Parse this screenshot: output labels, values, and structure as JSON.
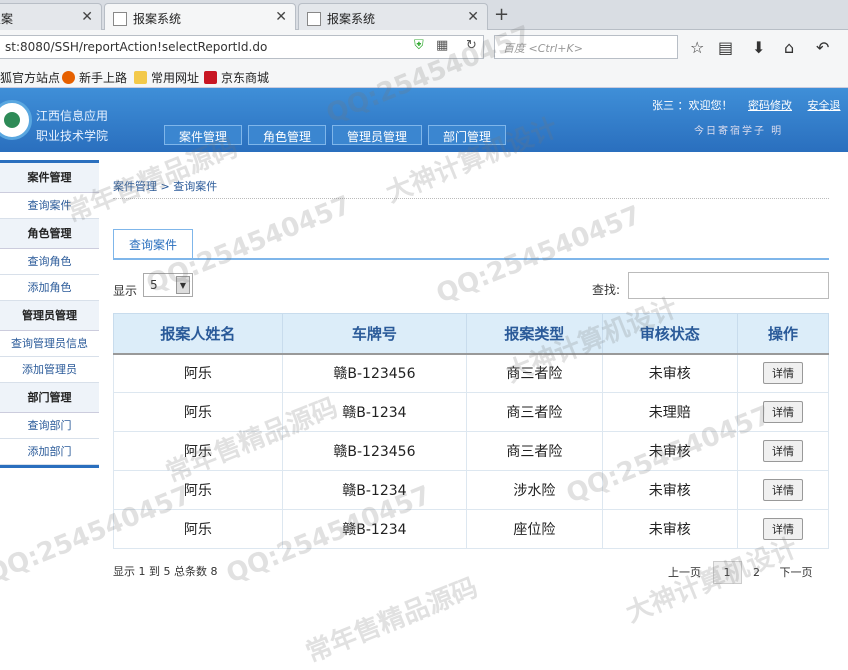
{
  "browser": {
    "tabs": [
      {
        "title": "搜案"
      },
      {
        "title": "报案系统"
      },
      {
        "title": "报案系统"
      }
    ],
    "url": "st:8080/SSH/reportAction!selectReportId.do",
    "search_placeholder": "百度 <Ctrl+K>",
    "bookmarks": [
      "狐官方站点",
      "新手上路",
      "常用网址",
      "京东商城"
    ]
  },
  "app": {
    "school_line1": "江西信息应用",
    "school_line2": "职业技术学院",
    "nav": [
      "案件管理",
      "角色管理",
      "管理员管理",
      "部门管理"
    ],
    "welcome": "张三 ：欢迎您！",
    "change_password": "密码修改",
    "logout": "安全退",
    "motto": "今日寄宿学子      明"
  },
  "sidebar": {
    "groups": [
      {
        "title": "案件管理",
        "items": [
          "查询案件"
        ]
      },
      {
        "title": "角色管理",
        "items": [
          "查询角色",
          "添加角色"
        ]
      },
      {
        "title": "管理员管理",
        "items": [
          "查询管理员信息",
          "添加管理员"
        ]
      },
      {
        "title": "部门管理",
        "items": [
          "查询部门",
          "添加部门"
        ]
      }
    ]
  },
  "content": {
    "breadcrumb": "案件管理 > 查询案件",
    "tab": "查询案件",
    "show_label": "显示",
    "page_size": "5",
    "find_label": "查找:",
    "columns": [
      "报案人姓名",
      "车牌号",
      "报案类型",
      "审核状态",
      "操作"
    ],
    "rows": [
      [
        "阿乐",
        "赣B-123456",
        "商三者险",
        "未审核",
        "详情"
      ],
      [
        "阿乐",
        "赣B-1234",
        "商三者险",
        "未理赔",
        "详情"
      ],
      [
        "阿乐",
        "赣B-123456",
        "商三者险",
        "未审核",
        "详情"
      ],
      [
        "阿乐",
        "赣B-1234",
        "涉水险",
        "未审核",
        "详情"
      ],
      [
        "阿乐",
        "赣B-1234",
        "座位险",
        "未审核",
        "详情"
      ]
    ],
    "info": "显示 1 到 5 总条数 8",
    "pager": {
      "prev": "上一页",
      "pages": [
        "1",
        "2"
      ],
      "next": "下一页"
    }
  },
  "watermarks": [
    "QQ:254540457",
    "大神计算机设计",
    "常年售精品源码"
  ]
}
